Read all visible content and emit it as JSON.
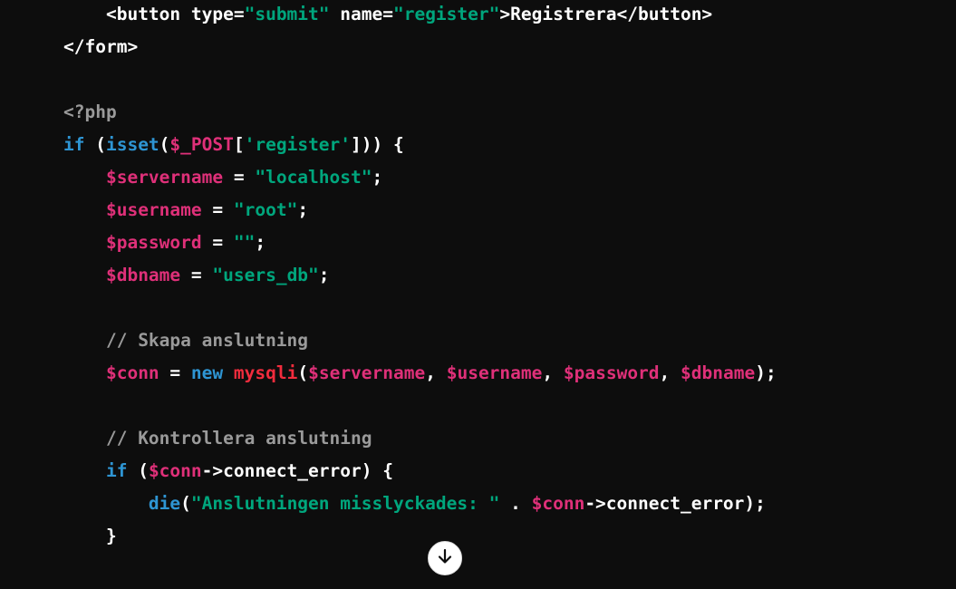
{
  "code_lines": [
    {
      "indent": "    ",
      "tokens": [
        {
          "t": "<button type=",
          "c": "pl"
        },
        {
          "t": "\"submit\"",
          "c": "str"
        },
        {
          "t": " name=",
          "c": "pl"
        },
        {
          "t": "\"register\"",
          "c": "str"
        },
        {
          "t": ">Registrera</button>",
          "c": "pl"
        }
      ]
    },
    {
      "indent": "",
      "tokens": [
        {
          "t": "</form>",
          "c": "pl"
        }
      ]
    },
    {
      "indent": "",
      "tokens": []
    },
    {
      "indent": "",
      "tokens": [
        {
          "t": "<?php",
          "c": "cmt"
        }
      ]
    },
    {
      "indent": "",
      "tokens": [
        {
          "t": "if",
          "c": "kw"
        },
        {
          "t": " (",
          "c": "pl"
        },
        {
          "t": "isset",
          "c": "kw"
        },
        {
          "t": "(",
          "c": "pl"
        },
        {
          "t": "$_POST",
          "c": "var"
        },
        {
          "t": "[",
          "c": "pl"
        },
        {
          "t": "'register'",
          "c": "str"
        },
        {
          "t": "])) {",
          "c": "pl"
        }
      ]
    },
    {
      "indent": "    ",
      "tokens": [
        {
          "t": "$servername",
          "c": "var"
        },
        {
          "t": " = ",
          "c": "pl"
        },
        {
          "t": "\"localhost\"",
          "c": "str"
        },
        {
          "t": ";",
          "c": "pl"
        }
      ]
    },
    {
      "indent": "    ",
      "tokens": [
        {
          "t": "$username",
          "c": "var"
        },
        {
          "t": " = ",
          "c": "pl"
        },
        {
          "t": "\"root\"",
          "c": "str"
        },
        {
          "t": ";",
          "c": "pl"
        }
      ]
    },
    {
      "indent": "    ",
      "tokens": [
        {
          "t": "$password",
          "c": "var"
        },
        {
          "t": " = ",
          "c": "pl"
        },
        {
          "t": "\"\"",
          "c": "str"
        },
        {
          "t": ";",
          "c": "pl"
        }
      ]
    },
    {
      "indent": "    ",
      "tokens": [
        {
          "t": "$dbname",
          "c": "var"
        },
        {
          "t": " = ",
          "c": "pl"
        },
        {
          "t": "\"users_db\"",
          "c": "str"
        },
        {
          "t": ";",
          "c": "pl"
        }
      ]
    },
    {
      "indent": "",
      "tokens": []
    },
    {
      "indent": "    ",
      "tokens": [
        {
          "t": "// Skapa anslutning",
          "c": "cmt"
        }
      ]
    },
    {
      "indent": "    ",
      "tokens": [
        {
          "t": "$conn",
          "c": "var"
        },
        {
          "t": " = ",
          "c": "pl"
        },
        {
          "t": "new",
          "c": "kw"
        },
        {
          "t": " ",
          "c": "pl"
        },
        {
          "t": "mysqli",
          "c": "fn"
        },
        {
          "t": "(",
          "c": "pl"
        },
        {
          "t": "$servername",
          "c": "var"
        },
        {
          "t": ", ",
          "c": "pl"
        },
        {
          "t": "$username",
          "c": "var"
        },
        {
          "t": ", ",
          "c": "pl"
        },
        {
          "t": "$password",
          "c": "var"
        },
        {
          "t": ", ",
          "c": "pl"
        },
        {
          "t": "$dbname",
          "c": "var"
        },
        {
          "t": ");",
          "c": "pl"
        }
      ]
    },
    {
      "indent": "",
      "tokens": []
    },
    {
      "indent": "    ",
      "tokens": [
        {
          "t": "// Kontrollera anslutning",
          "c": "cmt"
        }
      ]
    },
    {
      "indent": "    ",
      "tokens": [
        {
          "t": "if",
          "c": "kw"
        },
        {
          "t": " (",
          "c": "pl"
        },
        {
          "t": "$conn",
          "c": "var"
        },
        {
          "t": "->connect_error) {",
          "c": "pl"
        }
      ]
    },
    {
      "indent": "        ",
      "tokens": [
        {
          "t": "die",
          "c": "kw"
        },
        {
          "t": "(",
          "c": "pl"
        },
        {
          "t": "\"Anslutningen misslyckades: \"",
          "c": "str"
        },
        {
          "t": " . ",
          "c": "pl"
        },
        {
          "t": "$conn",
          "c": "var"
        },
        {
          "t": "->connect_error);",
          "c": "pl"
        }
      ]
    },
    {
      "indent": "    ",
      "tokens": [
        {
          "t": "}",
          "c": "pl"
        }
      ]
    }
  ],
  "scroll_button": {
    "icon": "arrow-down-icon"
  },
  "colors": {
    "background": "#0d0d0d",
    "keyword": "#2e95d3",
    "string": "#00a67d",
    "variable": "#df3079",
    "function": "#f22c3d",
    "comment": "#9a9a9a",
    "plain": "#ffffff"
  }
}
